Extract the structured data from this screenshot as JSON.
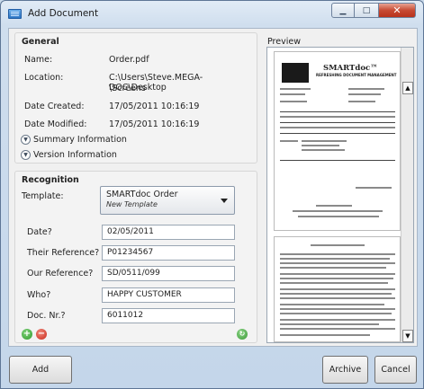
{
  "window": {
    "title": "Add Document"
  },
  "general": {
    "heading": "General",
    "name_label": "Name:",
    "name_value": "Order.pdf",
    "location_label": "Location:",
    "location_line1": "C:\\Users\\Steve.MEGA-DOC\\Desktop",
    "location_line2": "\\Screens",
    "created_label": "Date Created:",
    "created_value": "17/05/2011 10:16:19",
    "modified_label": "Date Modified:",
    "modified_value": "17/05/2011 10:16:19",
    "summary_label": "Summary Information",
    "version_label": "Version Information"
  },
  "recognition": {
    "heading": "Recognition",
    "template_label": "Template:",
    "template_value": "SMARTdoc Order",
    "template_sub": "New Template",
    "fields": [
      {
        "label": "Date?",
        "value": "02/05/2011"
      },
      {
        "label": "Their Reference?",
        "value": "P01234567"
      },
      {
        "label": "Our Reference?",
        "value": "SD/0511/099"
      },
      {
        "label": "Who?",
        "value": "HAPPY CUSTOMER"
      },
      {
        "label": "Doc. Nr.?",
        "value": "6011012"
      }
    ]
  },
  "preview": {
    "label": "Preview",
    "logo_text": "SMARTdoc™",
    "logo_sub": "REFRESHING DOCUMENT MANAGEMENT"
  },
  "buttons": {
    "add": "Add",
    "archive": "Archive",
    "cancel": "Cancel"
  },
  "icons": {
    "app": "document-icon",
    "minimize": "minimize-icon",
    "maximize": "maximize-icon",
    "close": "close-icon",
    "expand": "chevron-down-icon",
    "add_field": "plus-icon",
    "remove_field": "minus-icon",
    "refresh": "refresh-icon"
  }
}
